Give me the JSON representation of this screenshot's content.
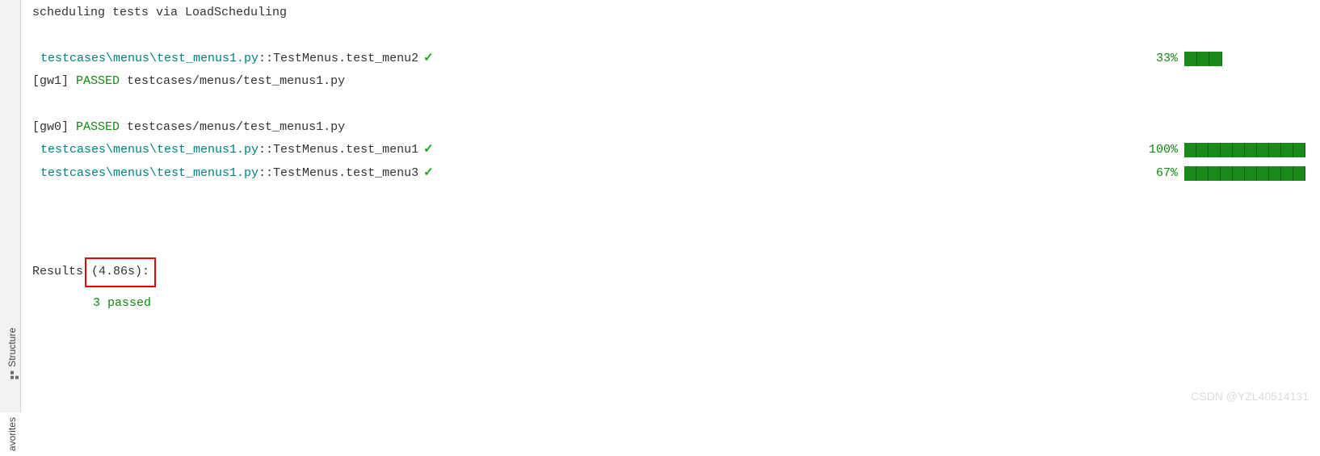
{
  "sidebar": {
    "tabs": [
      {
        "label": "Structure"
      },
      {
        "label": "avorites"
      }
    ]
  },
  "header_line": "scheduling tests via LoadScheduling",
  "tests": [
    {
      "path": "testcases\\menus\\test_menus1.py",
      "node": "::TestMenus.test_menu2",
      "percent": "33%",
      "segments_filled": 3,
      "segments_total": 10
    },
    {
      "path": "testcases\\menus\\test_menus1.py",
      "node": "::TestMenus.test_menu1",
      "percent": "100%",
      "segments_filled": 10,
      "segments_total": 10
    },
    {
      "path": "testcases\\menus\\test_menus1.py",
      "node": "::TestMenus.test_menu3",
      "percent": "67%",
      "segments_filled": 10,
      "segments_total": 10
    }
  ],
  "workers": [
    {
      "prefix": "[gw1] ",
      "status": "PASSED",
      "file": " testcases/menus/test_menus1.py"
    },
    {
      "prefix": "[gw0] ",
      "status": "PASSED",
      "file": " testcases/menus/test_menus1.py"
    }
  ],
  "results": {
    "label": "Results",
    "time": " (4.86s):",
    "passed": "3 passed"
  },
  "watermark": "CSDN @YZL40514131",
  "check_glyph": "✓"
}
